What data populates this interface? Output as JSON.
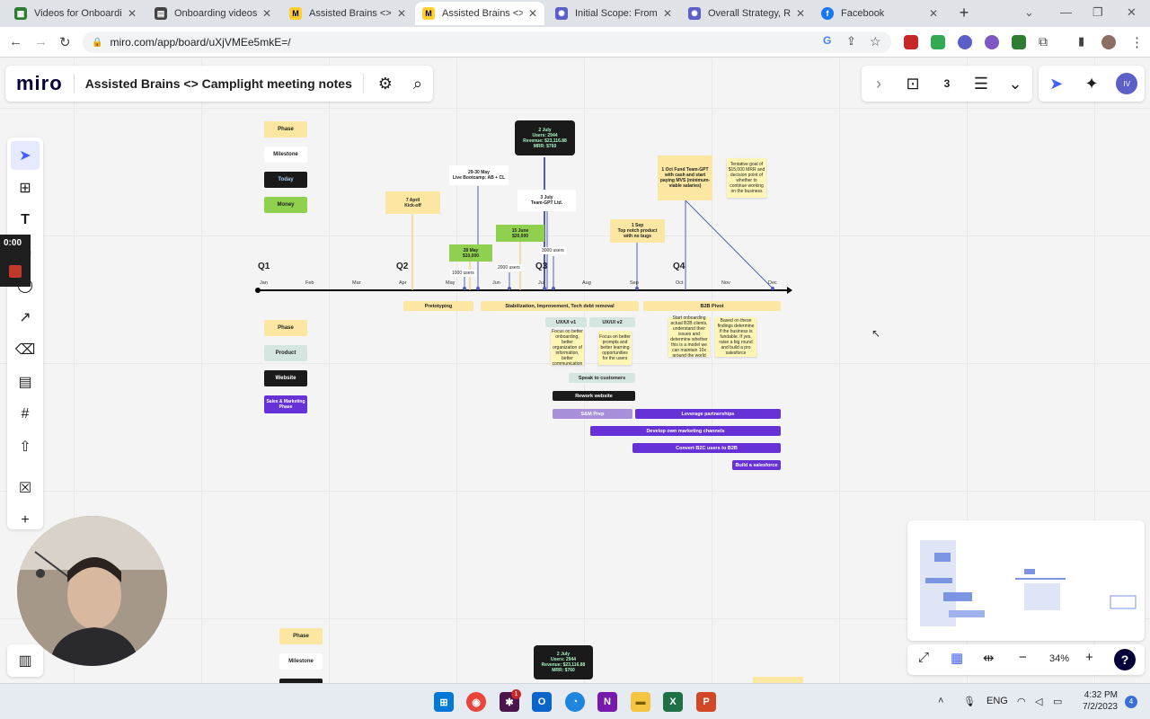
{
  "browser": {
    "tabs": [
      {
        "title": "Videos for Onboardi",
        "favicon_color": "#2e7d32",
        "active": false
      },
      {
        "title": "Onboarding videos",
        "favicon_color": "#444444",
        "active": false
      },
      {
        "title": "Assisted Brains <> C",
        "favicon_color": "#ffd02f",
        "active": false
      },
      {
        "title": "Assisted Brains <> C",
        "favicon_color": "#ffd02f",
        "active": true
      },
      {
        "title": "Initial Scope: From P",
        "favicon_color": "#5b5fc7",
        "active": false
      },
      {
        "title": "Overall Strategy, Ro",
        "favicon_color": "#5b5fc7",
        "active": false
      },
      {
        "title": "Facebook",
        "favicon_color": "#1877f2",
        "active": false
      }
    ],
    "url": "miro.com/app/board/uXjVMEe5mkE=/"
  },
  "miro": {
    "logo": "miro",
    "board_title": "Assisted Brains <> Camplight meeting notes",
    "zoom": "34%",
    "avatar_initials": "IV",
    "recorder_time": "0:00"
  },
  "board": {
    "legend_top": [
      "Phase",
      "Milestone",
      "Today",
      "Money"
    ],
    "legend_mid": [
      "Phase",
      "Product",
      "Website",
      "Sales & Marketing Phase"
    ],
    "legend_bottom": [
      "Phase",
      "Milestone"
    ],
    "quarters": [
      "Q1",
      "Q2",
      "Q3",
      "Q4"
    ],
    "months": [
      "Jan",
      "Feb",
      "Mar",
      "Apr",
      "May",
      "Jun",
      "Jul",
      "Aug",
      "Sep",
      "Oct",
      "Nov",
      "Dec"
    ],
    "today_note": "2 July\nUsers: 2944\nRevenue: $23,116.88\nMRR: $760",
    "kickoff_note": "7 April\nKick-off",
    "bootcamp_note": "29-30 May\nLive Bootcamp: AB + CL",
    "money_may": "28 May\n$10,000",
    "money_june": "15 June\n$20,000",
    "ltd_note": "3 July\nTeam-GPT Ltd.",
    "sep_note": "1 Sep\nTop notch product\nwith no bugs",
    "oct_note": "1 Oct\nFund Team-GPT with cash and start paying MVS (minimum-viable salaries)",
    "goal_note": "Tentative goal of $15,000 MRR and decision point of whether to continue working on the business",
    "user_labels": [
      "1000 users",
      "2000 users",
      "3000 users"
    ],
    "phases": [
      "Pretotyping",
      "Stabilization, Improvement, Tech debt removal",
      "B2B Pivot"
    ],
    "product": [
      "UX/UI v1",
      "UX/UI v2",
      "Speak to customers"
    ],
    "product_notes": [
      "Focus on better onboarding, better organization of information, better communication",
      "Focus on better prompts and better learning opportunities for the users"
    ],
    "b2b_notes": [
      "Start onboarding actual B2B clients, understand their issues and determine whether this is a model we can maintain 10x around the world",
      "Based on these findings determine if the business is fundable. If yes, raise a big round and build a pro salesforce"
    ],
    "website": "Rework website",
    "sales": [
      "S&M Prep",
      "Leverage partnerships",
      "Develop own marketing channels",
      "Convert B2C users to B2B",
      "Build a salesforce"
    ],
    "bottom_note": "2 July\nUsers: 2944\nRevenue: $23,116.88\nMRR: $760"
  },
  "taskbar": {
    "lang": "ENG",
    "time": "4:32 PM",
    "date": "7/2/2023",
    "notif_count": "4",
    "slack_badge": "1"
  },
  "colors": {
    "phase": "#fbe6a2",
    "money": "#8fd14f",
    "product": "#d5e6e1",
    "sales": "#6631d7",
    "sales_light": "#a88fd9",
    "miro_navy": "#050038",
    "accent": "#4262ff"
  }
}
